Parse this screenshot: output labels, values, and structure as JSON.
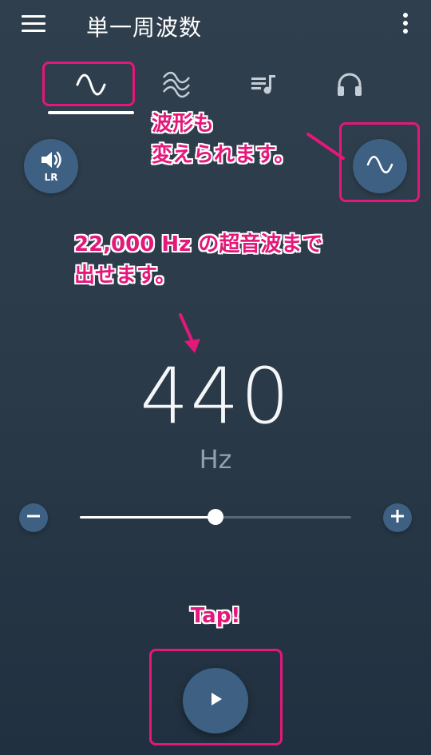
{
  "app": {
    "title": "単一周波数"
  },
  "tabs": [
    {
      "id": "single-wave",
      "icon": "sine-wave-icon",
      "selected": true
    },
    {
      "id": "multi-wave",
      "icon": "layered-wave-icon",
      "selected": false
    },
    {
      "id": "playlist",
      "icon": "playlist-icon",
      "selected": false
    },
    {
      "id": "headphones",
      "icon": "headphones-icon",
      "selected": false
    },
    {
      "id": "more",
      "icon": "sweep-icon",
      "selected": false
    }
  ],
  "controls": {
    "speaker_badge": "LR",
    "speaker_icon": "speaker-icon",
    "waveform_icon": "sine-wave-icon"
  },
  "frequency": {
    "value": "440",
    "unit": "Hz",
    "slider_fraction": 0.5
  },
  "buttons": {
    "decrease_icon": "minus-icon",
    "increase_icon": "plus-icon",
    "play_icon": "play-icon"
  },
  "annotations": {
    "waveform_note_line1": "波形も",
    "waveform_note_line2": "変えられます。",
    "range_note_line1": "22,000 Hz の超音波まで",
    "range_note_line2": "出せます。",
    "tap_note": "Tap!"
  },
  "colors": {
    "accent_button": "#3d6083",
    "annotation": "#e4177a",
    "background": "#2b3b49"
  }
}
